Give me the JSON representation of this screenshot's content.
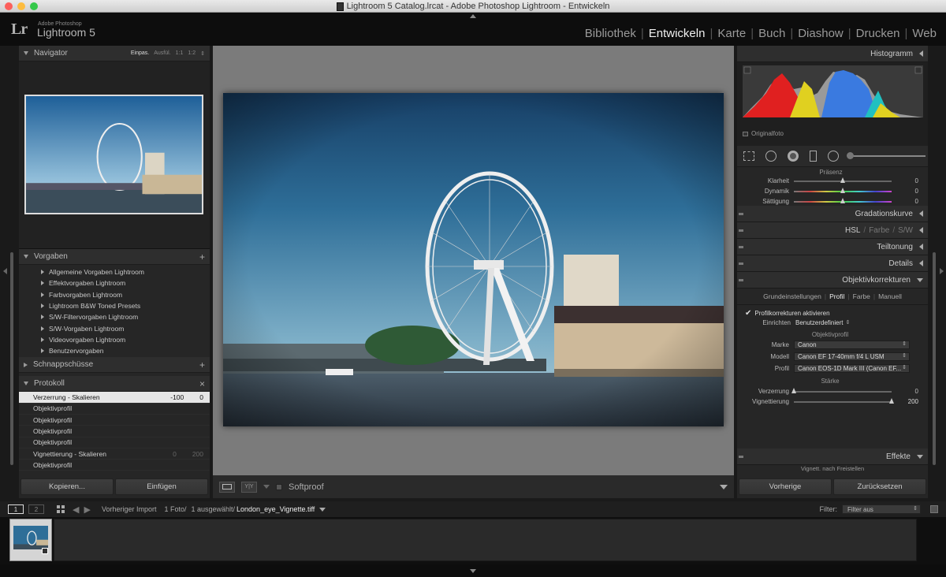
{
  "window": {
    "title": "Lightroom 5 Catalog.lrcat - Adobe Photoshop Lightroom - Entwickeln"
  },
  "brand": {
    "mark": "Lr",
    "company": "Adobe Photoshop",
    "product": "Lightroom 5"
  },
  "modules": [
    "Bibliothek",
    "Entwickeln",
    "Karte",
    "Buch",
    "Diashow",
    "Drucken",
    "Web"
  ],
  "active_module": "Entwickeln",
  "navigator": {
    "title": "Navigator",
    "options": [
      "Einpas.",
      "Ausfül.",
      "1:1",
      "1:2"
    ],
    "selected_option": "Einpas."
  },
  "presets": {
    "title": "Vorgaben",
    "items": [
      "Allgemeine Vorgaben Lightroom",
      "Effektvorgaben Lightroom",
      "Farbvorgaben Lightroom",
      "Lightroom B&W Toned Presets",
      "S/W-Filtervorgaben Lightroom",
      "S/W-Vorgaben Lightroom",
      "Videovorgaben Lightroom",
      "Benutzervorgaben"
    ]
  },
  "snapshots": {
    "title": "Schnappschüsse"
  },
  "history": {
    "title": "Protokoll",
    "items": [
      {
        "label": "Verzerrung - Skalieren",
        "a": "-100",
        "b": "0",
        "selected": true
      },
      {
        "label": "Objektivprofil",
        "a": "",
        "b": ""
      },
      {
        "label": "Objektivprofil",
        "a": "",
        "b": ""
      },
      {
        "label": "Objektivprofil",
        "a": "",
        "b": ""
      },
      {
        "label": "Objektivprofil",
        "a": "",
        "b": ""
      },
      {
        "label": "Vignettierung - Skalieren",
        "a": "0",
        "b": "200"
      },
      {
        "label": "Objektivprofil",
        "a": "",
        "b": ""
      }
    ]
  },
  "left_buttons": {
    "copy": "Kopieren...",
    "paste": "Einfügen"
  },
  "toolbar": {
    "softproof": "Softproof"
  },
  "histogram": {
    "title": "Histogramm",
    "original_photo": "Originalfoto"
  },
  "presence": {
    "title": "Präsenz",
    "sliders": [
      {
        "label": "Klarheit",
        "value": "0",
        "pos": 0.5
      },
      {
        "label": "Dynamik",
        "value": "0",
        "pos": 0.5
      },
      {
        "label": "Sättigung",
        "value": "0",
        "pos": 0.5
      }
    ]
  },
  "sections": {
    "tone_curve": "Gradationskurve",
    "hsl": "HSL",
    "hsl_color": "Farbe",
    "hsl_bw": "S/W",
    "split_toning": "Teiltonung",
    "detail": "Details",
    "lens": "Objektivkorrekturen",
    "effects": "Effekte",
    "effects_sub": "Vignett. nach Freistellen"
  },
  "lens": {
    "tabs": [
      "Grundeinstellungen",
      "Profil",
      "Farbe",
      "Manuell"
    ],
    "active_tab": "Profil",
    "enable_label": "Profilkorrekturen aktivieren",
    "setup_label": "Einrichten",
    "setup_value": "Benutzerdefiniert",
    "profile_heading": "Objektivprofil",
    "make_label": "Marke",
    "make_value": "Canon",
    "model_label": "Modell",
    "model_value": "Canon EF 17-40mm f/4 L USM",
    "profile_label": "Profil",
    "profile_value": "Canon EOS-1D Mark III (Canon EF...",
    "amount_heading": "Stärke",
    "distortion_label": "Verzerrung",
    "distortion_value": "0",
    "distortion_pos": 0.0,
    "vignetting_label": "Vignettierung",
    "vignetting_value": "200",
    "vignetting_pos": 1.0
  },
  "right_buttons": {
    "previous": "Vorherige",
    "reset": "Zurücksetzen"
  },
  "filmstrip": {
    "page1": "1",
    "page2": "2",
    "source": "Vorheriger Import",
    "count": "1 Foto/",
    "selected": "1 ausgewählt/",
    "filename": "London_eye_Vignette.tiff",
    "filter_label": "Filter:",
    "filter_value": "Filter aus"
  }
}
